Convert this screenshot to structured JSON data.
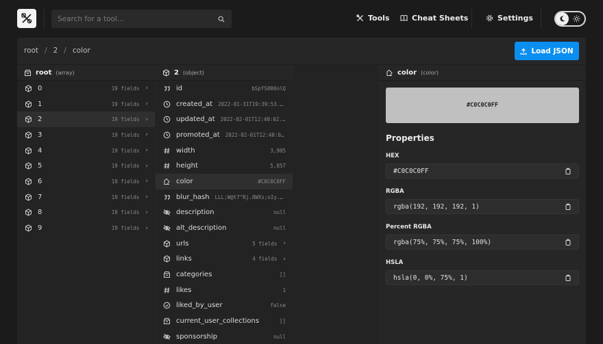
{
  "header": {
    "search_placeholder": "Search for a tool...",
    "nav": [
      {
        "label": "Tools",
        "icon": "tools-icon"
      },
      {
        "label": "Cheat Sheets",
        "icon": "book-icon"
      },
      {
        "label": "Settings",
        "icon": "gear-icon"
      }
    ]
  },
  "breadcrumb": [
    "root",
    "2",
    "color"
  ],
  "load_button": "Load JSON",
  "col1": {
    "title": "root",
    "type": "(array)",
    "rows": [
      {
        "key": "0",
        "val": "19 fields"
      },
      {
        "key": "1",
        "val": "19 fields"
      },
      {
        "key": "2",
        "val": "19 fields"
      },
      {
        "key": "3",
        "val": "19 fields"
      },
      {
        "key": "4",
        "val": "19 fields"
      },
      {
        "key": "5",
        "val": "19 fields"
      },
      {
        "key": "6",
        "val": "19 fields"
      },
      {
        "key": "7",
        "val": "19 fields"
      },
      {
        "key": "8",
        "val": "19 fields"
      },
      {
        "key": "9",
        "val": "19 fields"
      }
    ]
  },
  "col2": {
    "title": "2",
    "type": "(object)",
    "rows": [
      {
        "key": "id",
        "val": "bSpYS000olQ",
        "icon": "quote"
      },
      {
        "key": "created_at",
        "val": "2022-01-31T19:39:53...",
        "icon": "clock"
      },
      {
        "key": "updated_at",
        "val": "2022-02-01T12:40:02...",
        "icon": "clock"
      },
      {
        "key": "promoted_at",
        "val": "2022-02-01T12:40:0...",
        "icon": "clock"
      },
      {
        "key": "width",
        "val": "3,905",
        "icon": "hash"
      },
      {
        "key": "height",
        "val": "5,857",
        "icon": "hash"
      },
      {
        "key": "color",
        "val": "#C0C0C0FF",
        "icon": "paint"
      },
      {
        "key": "blur_hash",
        "val": "LLL;W@t7^Rj.8WXs;oIy...",
        "icon": "quote"
      },
      {
        "key": "description",
        "val": "null",
        "icon": "eye-off"
      },
      {
        "key": "alt_description",
        "val": "null",
        "icon": "eye-off"
      },
      {
        "key": "urls",
        "val": "5 fields",
        "icon": "cube"
      },
      {
        "key": "links",
        "val": "4 fields",
        "icon": "cube"
      },
      {
        "key": "categories",
        "val": "[]",
        "icon": "tray"
      },
      {
        "key": "likes",
        "val": "1",
        "icon": "hash"
      },
      {
        "key": "liked_by_user",
        "val": "false",
        "icon": "check"
      },
      {
        "key": "current_user_collections",
        "val": "[]",
        "icon": "tray"
      },
      {
        "key": "sponsorship",
        "val": "null",
        "icon": "eye-off"
      }
    ]
  },
  "col4": {
    "title": "color",
    "type": "(color)",
    "swatch_text": "#C0C0C0FF",
    "swatch_color": "#c0c0c0",
    "properties_title": "Properties",
    "props": [
      {
        "label": "HEX",
        "value": "#C0C0C0FF"
      },
      {
        "label": "RGBA",
        "value": "rgba(192, 192, 192, 1)"
      },
      {
        "label": "Percent RGBA",
        "value": "rgba(75%, 75%, 75%, 100%)"
      },
      {
        "label": "HSLA",
        "value": "hsla(0, 0%, 75%, 1)"
      }
    ]
  }
}
